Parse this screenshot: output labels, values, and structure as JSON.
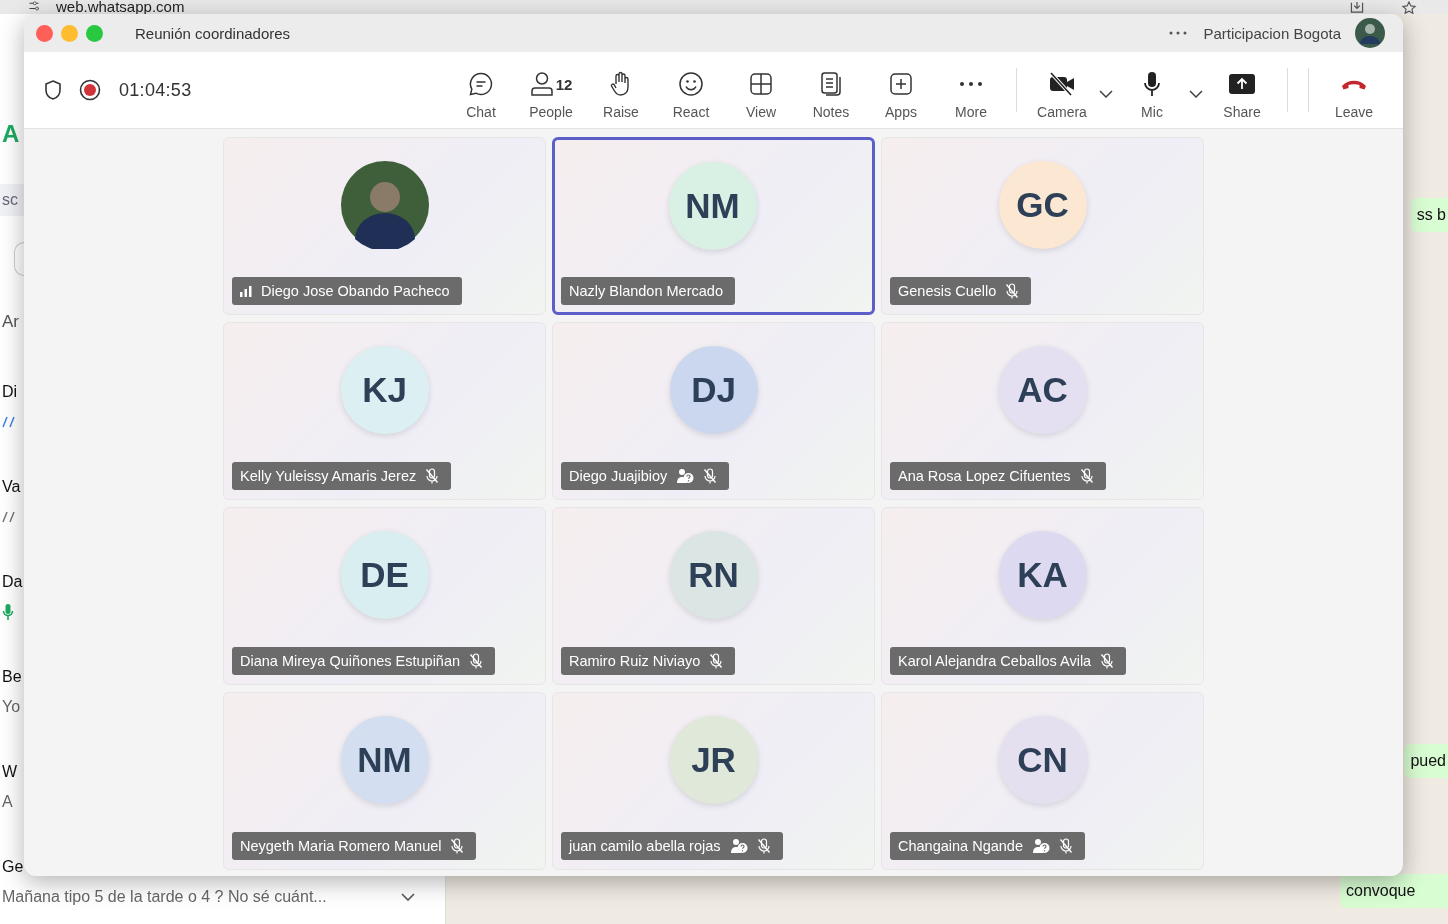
{
  "browser": {
    "url": "web.whatsapp.com"
  },
  "whatsapp": {
    "logo": "A",
    "search": "sc",
    "archived": "Ar",
    "chats": [
      {
        "title": "Di",
        "kind": "read",
        "menu": false
      },
      {
        "title": "Va",
        "kind": "delivered",
        "menu": false
      },
      {
        "title": "Da",
        "kind": "voice",
        "menu": false
      },
      {
        "title": "Be",
        "kind": "text",
        "preview": "Yo",
        "menu": false
      },
      {
        "title": "W",
        "kind": "text",
        "preview": "A",
        "menu": false
      },
      {
        "title": "Ge",
        "kind": "text",
        "preview": "Mañana tipo 5 de la tarde o 4 ?  No sé cuánt...",
        "menu": true
      }
    ],
    "bubbles": [
      "ss b",
      "pued",
      "convoque"
    ]
  },
  "window": {
    "title": "Reunión coordinadores",
    "account": "Participacion Bogota",
    "timer": "01:04:53",
    "recording": true
  },
  "toolbar": [
    {
      "kind": "chat",
      "label": "Chat"
    },
    {
      "kind": "people",
      "label": "People",
      "count": "12"
    },
    {
      "kind": "raise",
      "label": "Raise"
    },
    {
      "kind": "react",
      "label": "React"
    },
    {
      "kind": "view",
      "label": "View"
    },
    {
      "kind": "notes",
      "label": "Notes"
    },
    {
      "kind": "apps",
      "label": "Apps"
    },
    {
      "kind": "more",
      "label": "More"
    },
    {
      "kind": "camera",
      "label": "Camera",
      "off": true
    },
    {
      "kind": "mic",
      "label": "Mic",
      "off": false
    },
    {
      "kind": "share",
      "label": "Share"
    },
    {
      "kind": "leave",
      "label": "Leave"
    }
  ],
  "participants": [
    {
      "kind": "photo",
      "name": "Diego Jose Obando Pacheco",
      "selected": false,
      "muted": false,
      "weak_signal": true,
      "help": false
    },
    {
      "kind": "initials",
      "initials": "NM",
      "color": "#d9f0e4",
      "name": "Nazly Blandon Mercado",
      "selected": true,
      "muted": false,
      "weak_signal": false,
      "help": false
    },
    {
      "kind": "initials",
      "initials": "GC",
      "color": "#fce8d2",
      "name": "Genesis Cuello",
      "selected": false,
      "muted": true,
      "weak_signal": false,
      "help": false
    },
    {
      "kind": "initials",
      "initials": "KJ",
      "color": "#dcf0f3",
      "name": "Kelly Yuleissy Amaris Jerez",
      "selected": false,
      "muted": true,
      "weak_signal": false,
      "help": false
    },
    {
      "kind": "initials",
      "initials": "DJ",
      "color": "#cad7ef",
      "name": "Diego Juajibioy",
      "selected": false,
      "muted": true,
      "weak_signal": false,
      "help": true
    },
    {
      "kind": "initials",
      "initials": "AC",
      "color": "#e4e0f1",
      "name": "Ana Rosa Lopez Cifuentes",
      "selected": false,
      "muted": true,
      "weak_signal": false,
      "help": false
    },
    {
      "kind": "initials",
      "initials": "DE",
      "color": "#d9eef0",
      "name": "Diana Mireya Quiñones Estupiñan",
      "selected": false,
      "muted": true,
      "weak_signal": false,
      "help": false
    },
    {
      "kind": "initials",
      "initials": "RN",
      "color": "#dbe5e3",
      "name": "Ramiro Ruiz Niviayo",
      "selected": false,
      "muted": true,
      "weak_signal": false,
      "help": false
    },
    {
      "kind": "initials",
      "initials": "KA",
      "color": "#dcd9f0",
      "name": "Karol Alejandra Ceballos Avila",
      "selected": false,
      "muted": true,
      "weak_signal": false,
      "help": false
    },
    {
      "kind": "initials",
      "initials": "NM",
      "color": "#d3def0",
      "name": "Neygeth Maria Romero Manuel",
      "selected": false,
      "muted": true,
      "weak_signal": false,
      "help": false
    },
    {
      "kind": "initials",
      "initials": "JR",
      "color": "#dfe8d9",
      "name": "juan camilo abella rojas",
      "selected": false,
      "muted": true,
      "weak_signal": false,
      "help": true
    },
    {
      "kind": "initials",
      "initials": "CN",
      "color": "#e4e0f0",
      "name": "Changaina Ngande",
      "selected": false,
      "muted": true,
      "weak_signal": false,
      "help": true
    }
  ]
}
